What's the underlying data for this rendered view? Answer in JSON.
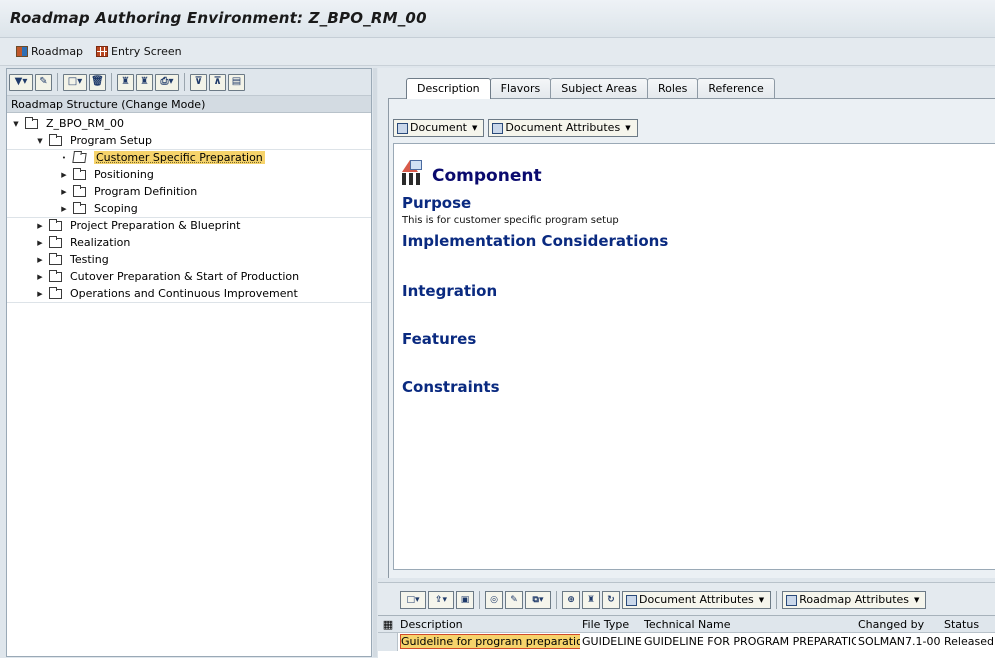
{
  "window": {
    "title": "Roadmap Authoring Environment: Z_BPO_RM_00"
  },
  "appbar": {
    "roadmap_label": "Roadmap",
    "entry_screen_label": "Entry Screen"
  },
  "left": {
    "structure_header": "Roadmap Structure (Change Mode)",
    "tree": [
      {
        "label": "Z_BPO_RM_00",
        "level": 0,
        "expanded": true
      },
      {
        "label": "Program Setup",
        "level": 1,
        "expanded": true
      },
      {
        "label": "Customer Specific Preparation",
        "level": 2,
        "selected": true
      },
      {
        "label": "Positioning",
        "level": 2
      },
      {
        "label": "Program Definition",
        "level": 2
      },
      {
        "label": "Scoping",
        "level": 2
      },
      {
        "label": "Project Preparation & Blueprint",
        "level": 1
      },
      {
        "label": "Realization",
        "level": 1
      },
      {
        "label": "Testing",
        "level": 1
      },
      {
        "label": "Cutover Preparation & Start of Production",
        "level": 1
      },
      {
        "label": "Operations and Continuous Improvement",
        "level": 1
      }
    ]
  },
  "tabs": [
    "Description",
    "Flavors",
    "Subject Areas",
    "Roles",
    "Reference"
  ],
  "active_tab": "Description",
  "doc_buttons": {
    "document": "Document",
    "document_attributes": "Document Attributes"
  },
  "document": {
    "component_heading": "Component",
    "purpose_heading": "Purpose",
    "purpose_text": "This is for customer specific program setup",
    "impl_heading": "Implementation Considerations",
    "integration_heading": "Integration",
    "features_heading": "Features",
    "constraints_heading": "Constraints"
  },
  "bottom": {
    "doc_attr_label": "Document Attributes",
    "roadmap_attr_label": "Roadmap Attributes",
    "columns": [
      "Description",
      "File Type",
      "Technical Name",
      "Changed by",
      "Status"
    ],
    "rows": [
      [
        "Guideline for program preparation",
        "GUIDELINE",
        "GUIDELINE FOR PROGRAM PREPARATION",
        "SOLMAN7.1-00",
        "Released"
      ]
    ]
  },
  "colors": {
    "heading": "#0a2a80",
    "selection": "#f6d36b"
  }
}
